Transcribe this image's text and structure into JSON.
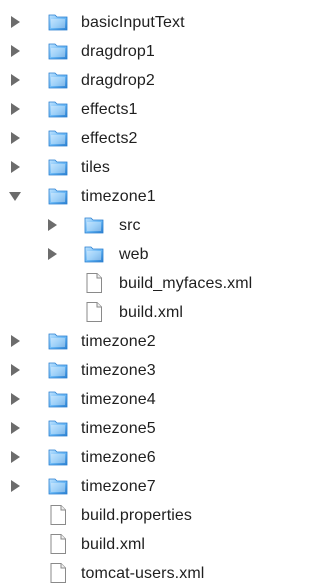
{
  "tree": {
    "items": [
      {
        "label": "basicInputText",
        "kind": "folder",
        "expanded": false,
        "level": 0
      },
      {
        "label": "dragdrop1",
        "kind": "folder",
        "expanded": false,
        "level": 0
      },
      {
        "label": "dragdrop2",
        "kind": "folder",
        "expanded": false,
        "level": 0
      },
      {
        "label": "effects1",
        "kind": "folder",
        "expanded": false,
        "level": 0
      },
      {
        "label": "effects2",
        "kind": "folder",
        "expanded": false,
        "level": 0
      },
      {
        "label": "tiles",
        "kind": "folder",
        "expanded": false,
        "level": 0
      },
      {
        "label": "timezone1",
        "kind": "folder",
        "expanded": true,
        "level": 0
      },
      {
        "label": "src",
        "kind": "folder",
        "expanded": false,
        "level": 1
      },
      {
        "label": "web",
        "kind": "folder",
        "expanded": false,
        "level": 1
      },
      {
        "label": "build_myfaces.xml",
        "kind": "file",
        "level": 1
      },
      {
        "label": "build.xml",
        "kind": "file",
        "level": 1
      },
      {
        "label": "timezone2",
        "kind": "folder",
        "expanded": false,
        "level": 0
      },
      {
        "label": "timezone3",
        "kind": "folder",
        "expanded": false,
        "level": 0
      },
      {
        "label": "timezone4",
        "kind": "folder",
        "expanded": false,
        "level": 0
      },
      {
        "label": "timezone5",
        "kind": "folder",
        "expanded": false,
        "level": 0
      },
      {
        "label": "timezone6",
        "kind": "folder",
        "expanded": false,
        "level": 0
      },
      {
        "label": "timezone7",
        "kind": "folder",
        "expanded": false,
        "level": 0
      },
      {
        "label": "build.properties",
        "kind": "file",
        "level": 0
      },
      {
        "label": "build.xml",
        "kind": "file",
        "level": 0
      },
      {
        "label": "tomcat-users.xml",
        "kind": "file",
        "level": 0
      }
    ]
  },
  "colors": {
    "folder_light": "#bfe3ff",
    "folder_mid": "#6ab8f5",
    "folder_dark": "#2a7fd0",
    "disclosure": "#6c6c6c",
    "text": "#1f1f1f",
    "file_stroke": "#8a8a8a"
  },
  "icons": {
    "folder": "folder-icon",
    "file": "file-icon",
    "collapsed": "disclosure-right-icon",
    "expanded": "disclosure-down-icon"
  }
}
